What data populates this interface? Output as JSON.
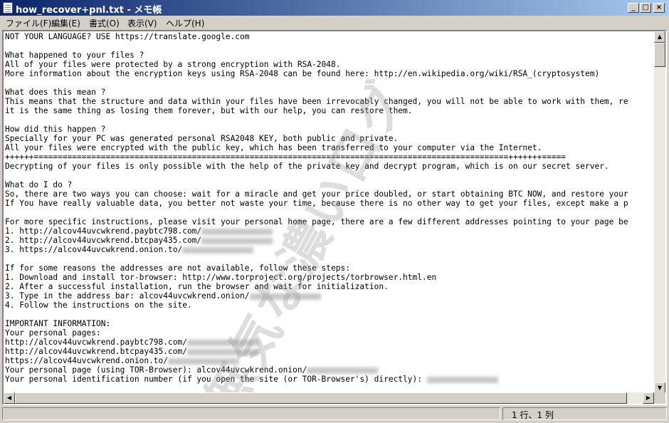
{
  "window": {
    "title": "how_recover+pnl.txt - メモ帳",
    "buttons": {
      "minimize": "_",
      "maximize": "□",
      "close": "×"
    }
  },
  "menu": [
    "ファイル(F)",
    "編集(E)",
    "書式(O)",
    "表示(V)",
    "ヘルプ(H)"
  ],
  "text": {
    "lines": [
      "NOT YOUR LANGUAGE? USE https://translate.google.com",
      "",
      "What happened to your files ?",
      "All of your files were protected by a strong encryption with RSA-2048.",
      "More information about the encryption keys using RSA-2048 can be found here: http://en.wikipedia.org/wiki/RSA_(cryptosystem)",
      "",
      "What does this mean ?",
      "This means that the structure and data within your files have been irrevocably changed, you will not be able to work with them, re",
      "it is the same thing as losing them forever, but with our help, you can restore them.",
      "",
      "How did this happen ?",
      "Specially for your PC was generated personal RSA2048 KEY, both public and private.",
      "All your files were encrypted with the public key, which has been transferred to your computer via the Internet.",
      "++++++===================================================================================================+++++++=====",
      "Decrypting of your files is only possible with the help of the private key and decrypt program, which is on our secret server.",
      "",
      "What do I do ?",
      "So, there are two ways you can choose: wait for a miracle and get your price doubled, or start obtaining BTC NOW, and restore your",
      "If You have really valuable data, you better not waste your time, because there is no other way to get your files, except make a p",
      "",
      "For more specific instructions, please visit your personal home page, there are a few different addresses pointing to your page be",
      "1. http://alcov44uvcwkrend.paybtc798.com/",
      "2. http://alcov44uvcwkrend.btcpay435.com/",
      "3. https://alcov44uvcwkrend.onion.to/",
      "",
      "If for some reasons the addresses are not available, follow these steps:",
      "1. Download and install tor-browser: http://www.torproject.org/projects/torbrowser.html.en",
      "2. After a successful installation, run the browser and wait for initialization.",
      "3. Type in the address bar: alcov44uvcwkrend.onion/",
      "4. Follow the instructions on the site.",
      "",
      "IMPORTANT INFORMATION:",
      "Your personal pages:",
      "http://alcov44uvcwkrend.paybtc798.com/",
      "http://alcov44uvcwkrend.btcpay435.com/",
      "https://alcov44uvcwkrend.onion.to/",
      "Your personal page (using TOR-Browser): alcov44uvcwkrend.onion/",
      "Your personal identification number (if you open the site (or TOR-Browser's) directly): "
    ],
    "watermark": "無気な濃い口グ"
  },
  "statusbar": {
    "position": "1 行、1 列"
  },
  "colors": {
    "title_start": "#0a246a",
    "title_end": "#a6caf0",
    "chrome": "#d4d0c8"
  }
}
